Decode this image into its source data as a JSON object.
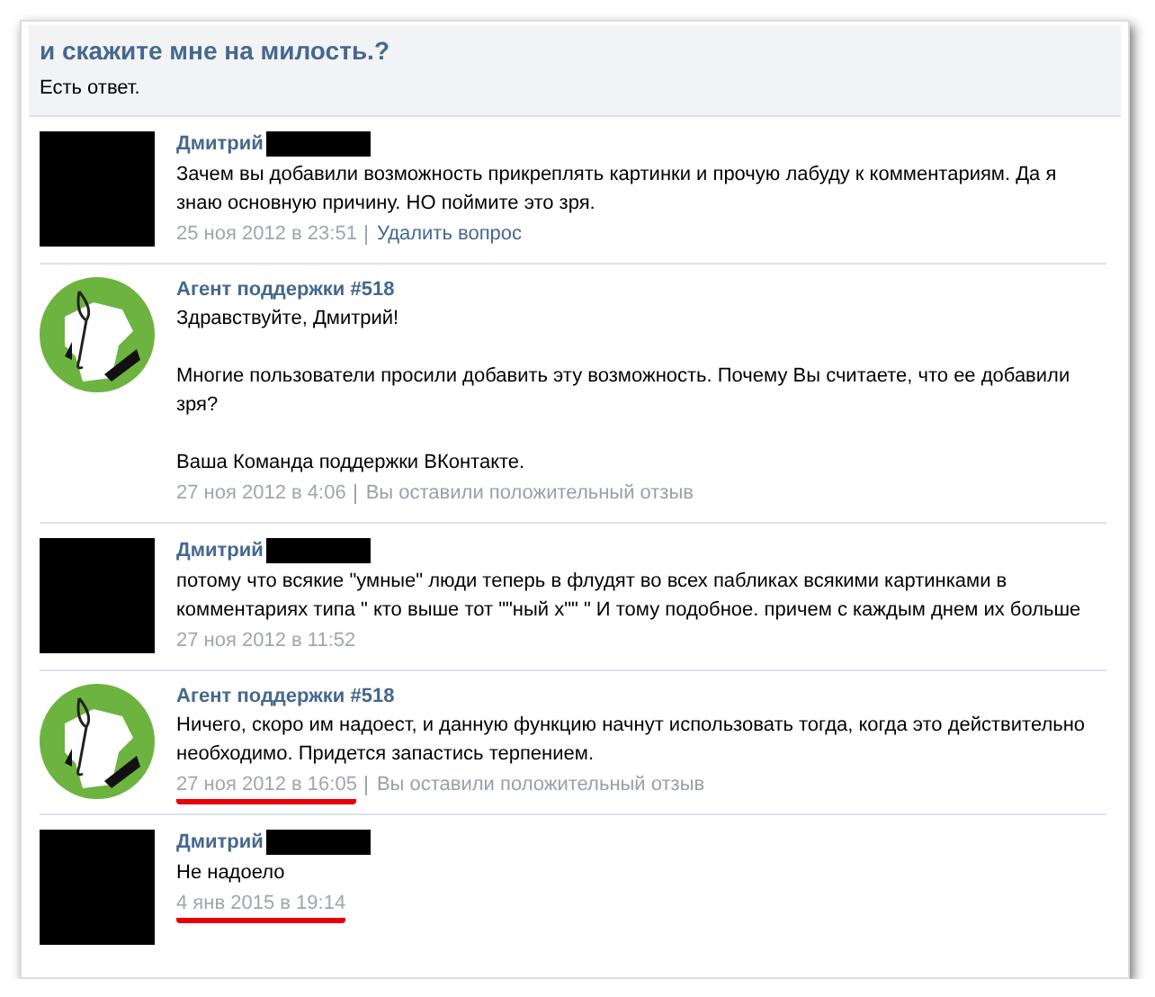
{
  "question": {
    "title": "и скажите мне на милость.?",
    "status": "Есть ответ."
  },
  "messages": [
    {
      "kind": "user",
      "author": "Дмитрий",
      "surname_redacted": true,
      "paragraphs": [
        "Зачем вы добавили возможность прикреплять картинки и прочую лабуду к комментариям. Да я знаю основную причину. НО поймите это зря."
      ],
      "date": "25 ноя 2012 в 23:51",
      "date_underlined": false,
      "action": "Удалить вопрос"
    },
    {
      "kind": "agent",
      "author": "Агент поддержки #518",
      "surname_redacted": false,
      "paragraphs": [
        "Здравствуйте, Дмитрий!",
        "Многие пользователи просили добавить эту возможность. Почему Вы считаете, что ее добавили зря?",
        "Ваша Команда поддержки ВКонтакте."
      ],
      "date": "27 ноя 2012 в 4:06",
      "date_underlined": false,
      "action": "Вы оставили положительный отзыв"
    },
    {
      "kind": "user",
      "author": "Дмитрий",
      "surname_redacted": true,
      "paragraphs": [
        "потому что всякие \"умные\" люди теперь в флудят во всех пабликах всякими картинками в комментариях типа \" кто выше тот \"\"ный х\"\" \" И тому подобное. причем с каждым днем их больше"
      ],
      "date": "27 ноя 2012 в 11:52",
      "date_underlined": false
    },
    {
      "kind": "agent",
      "author": "Агент поддержки #518",
      "surname_redacted": false,
      "paragraphs": [
        "Ничего, скоро им надоест, и данную функцию начнут использовать тогда, когда это действительно необходимо. Придется запастись терпением."
      ],
      "date": "27 ноя 2012 в 16:05",
      "date_underlined": true,
      "action": "Вы оставили положительный отзыв"
    },
    {
      "kind": "user",
      "author": "Дмитрий",
      "surname_redacted": true,
      "paragraphs": [
        "Не надоело"
      ],
      "date": "4 янв 2015 в 19:14",
      "date_underlined": true
    }
  ]
}
